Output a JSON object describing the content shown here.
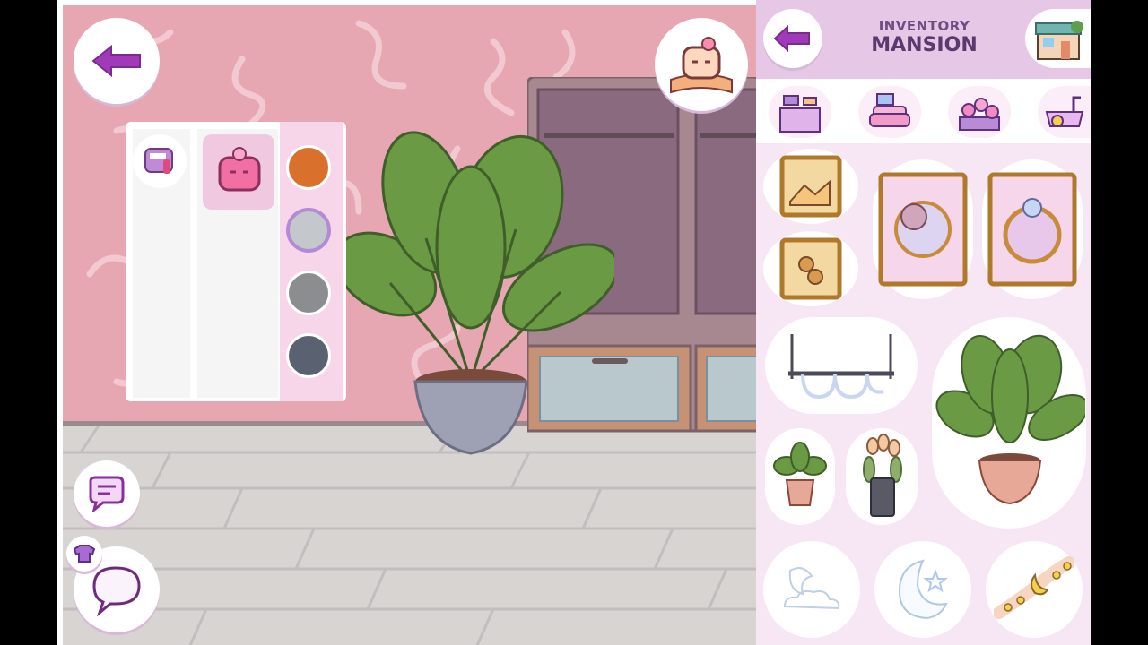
{
  "panel": {
    "title_small": "INVENTORY",
    "title_big": "MANSION"
  },
  "icons": {
    "back": "back-arrow-icon",
    "story": "story-book-icon",
    "chat": "chat-bubble-icon",
    "speech": "speech-bubble-icon",
    "outfit": "shirt-icon",
    "house": "house-icon"
  },
  "categories": [
    "kitchen",
    "living-room",
    "garden",
    "bathroom"
  ],
  "color_swatches": [
    "#d9702b",
    "#c4c7cc",
    "#8b8d8f",
    "#5a6170"
  ],
  "colors": {
    "wall": "#e6a6b2",
    "floor": "#d8d4d2",
    "panel_bg": "#f7e6f3",
    "panel_header": "#e6c7e6",
    "accent": "#9a38b0"
  }
}
